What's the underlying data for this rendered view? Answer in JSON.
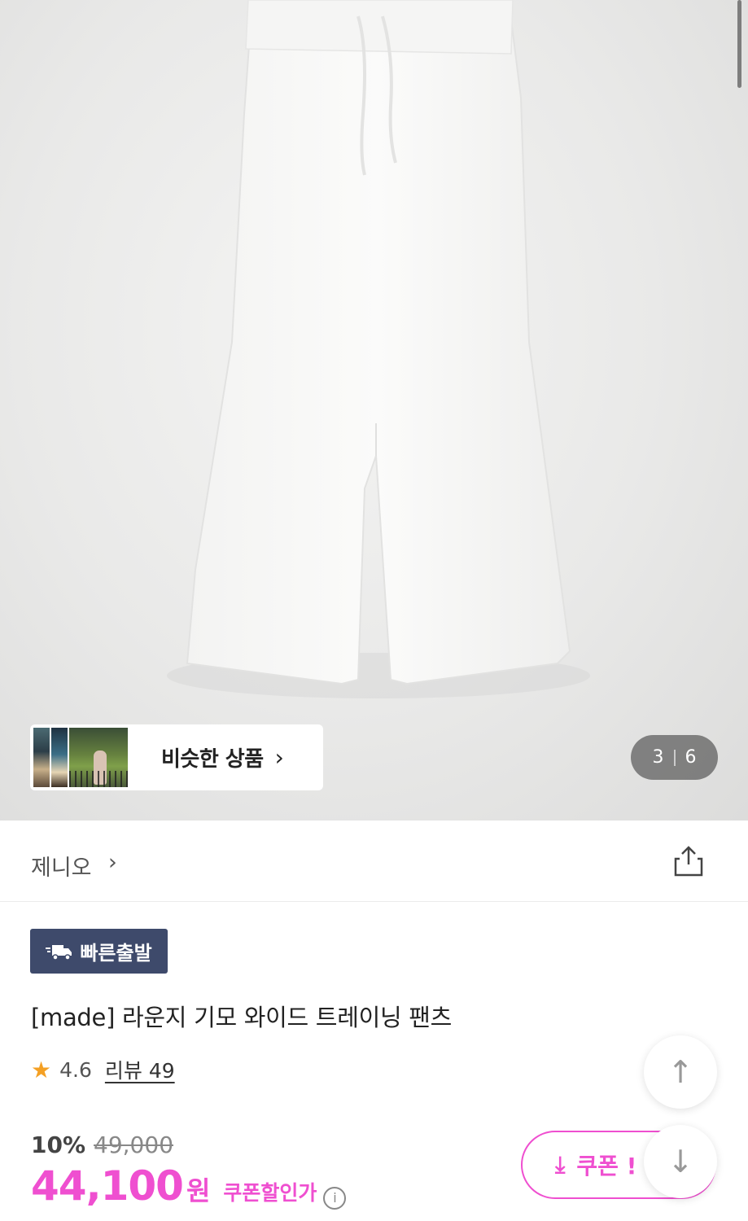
{
  "gallery": {
    "similar_label": "비슷한 상품",
    "counter_current": "3",
    "counter_total": "6"
  },
  "brand": {
    "name": "제니오"
  },
  "product": {
    "badge_label": "빠른출발",
    "title": "[made] 라운지 기모 와이드 트레이닝 팬츠",
    "rating": "4.6",
    "review_label": "리뷰 49"
  },
  "pricing": {
    "discount_rate": "10%",
    "original_price": "49,000",
    "sale_price": "44,100",
    "currency": "원",
    "coupon_price_label": "쿠폰할인가",
    "coupon_button_label": "쿠폰 !"
  },
  "colors": {
    "accent": "#ef4fd0",
    "badge_bg": "#3e4a6b",
    "star": "#f4a024"
  }
}
